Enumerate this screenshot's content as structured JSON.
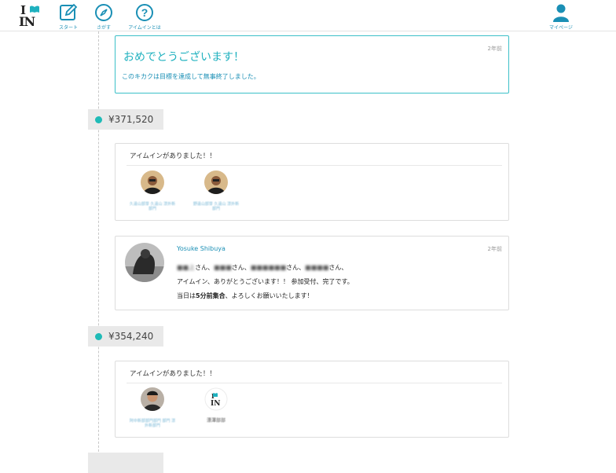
{
  "nav": {
    "logo": {
      "line1": "I",
      "line2": "IN"
    },
    "items": [
      {
        "label": "スタート",
        "icon": "pencil-icon"
      },
      {
        "label": "さがす",
        "icon": "compass-icon"
      },
      {
        "label": "アイムインとは",
        "icon": "question-icon"
      }
    ],
    "mypage": {
      "label": "マイページ",
      "icon": "user-icon"
    }
  },
  "colors": {
    "accent": "#1fb1bf",
    "link": "#1a8fb5",
    "dot": "#1fbbb7"
  },
  "completed": {
    "title": "おめでとうございます！",
    "text": "このキカクは目標を達成して無事終了しました。",
    "age": "2年前"
  },
  "timeline": [
    {
      "amount": "¥371,520"
    },
    {
      "amount": "¥354,240"
    }
  ],
  "aim_cards": [
    {
      "heading": "アイムインがありました！！",
      "supporters": [
        {
          "name": "久遠山部芽 久遠山 漂外新部門"
        },
        {
          "name": "野遠山部芽 久遠山 漂外新部門"
        }
      ]
    },
    {
      "heading": "アイムインがありました！！",
      "supporters": [
        {
          "name": "阿中新部部門部門 部門 漂外新部門"
        },
        {
          "name": "漂澤部部"
        }
      ]
    }
  ],
  "message": {
    "author": "Yosuke Shibuya",
    "age": "2年前",
    "line1_names": [
      "■■上",
      "■■■",
      "■■■■■■",
      "■■■■"
    ],
    "line1_suffixes": [
      "さん、",
      "さん、",
      "さん、",
      "さん、"
    ],
    "line2": "アイムイン、ありがとうございます！！ 参加受付、完了です。",
    "line3_pre": "当日は",
    "line3_bold": "5分前集合",
    "line3_post": "、よろしくお願いいたします！"
  }
}
